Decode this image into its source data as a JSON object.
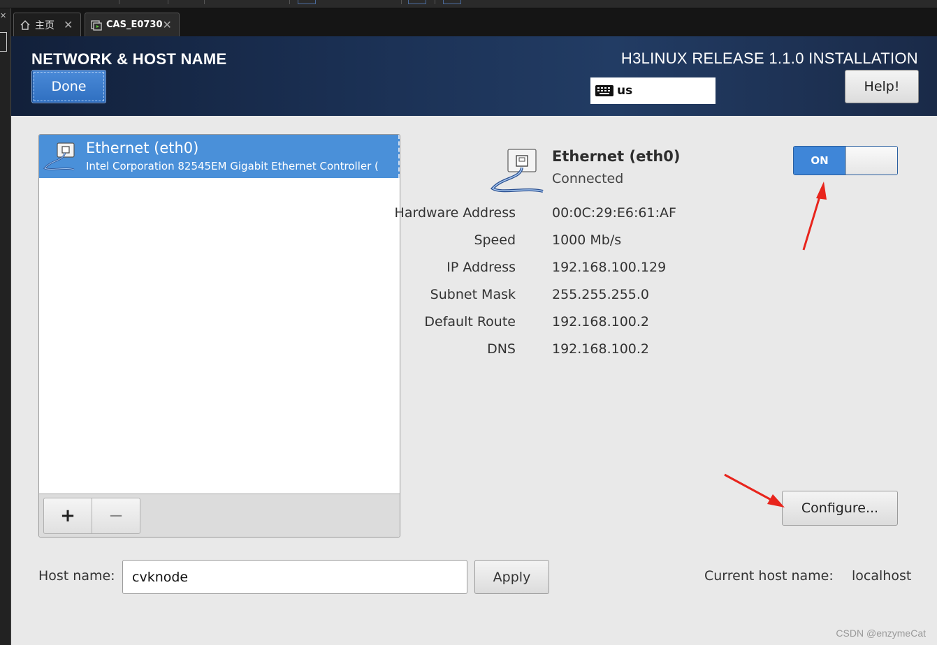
{
  "vm_tabs": [
    {
      "label": "主页",
      "icon": "home-icon"
    },
    {
      "label": "CAS_E0730",
      "icon": "vm-icon"
    }
  ],
  "header": {
    "title": "NETWORK & HOST NAME",
    "done_label": "Done",
    "release": "H3LINUX RELEASE 1.1.0 INSTALLATION",
    "keyboard_layout": "us",
    "help_label": "Help!"
  },
  "devices": [
    {
      "name": "Ethernet (eth0)",
      "description": "Intel Corporation 82545EM Gigabit Ethernet Controller (",
      "selected": true
    }
  ],
  "device_toolbar": {
    "add_label": "+",
    "remove_label": "−"
  },
  "detail": {
    "name": "Ethernet (eth0)",
    "status": "Connected",
    "toggle_label": "ON",
    "toggle_on": true,
    "rows": [
      {
        "label": "Hardware Address",
        "value": "00:0C:29:E6:61:AF"
      },
      {
        "label": "Speed",
        "value": "1000 Mb/s"
      },
      {
        "label": "IP Address",
        "value": "192.168.100.129"
      },
      {
        "label": "Subnet Mask",
        "value": "255.255.255.0"
      },
      {
        "label": "Default Route",
        "value": "192.168.100.2"
      },
      {
        "label": "DNS",
        "value": "192.168.100.2"
      }
    ],
    "configure_label": "Configure..."
  },
  "hostname": {
    "label": "Host name:",
    "value": "cvknode",
    "apply_label": "Apply",
    "current_label": "Current host name:",
    "current_value": "localhost"
  },
  "watermark": "CSDN @enzymeCat",
  "colors": {
    "header_bg": "#1a2f52",
    "accent_blue": "#4a90d9",
    "annotation_red": "#e8241c",
    "panel_bg": "#e9e9e9"
  }
}
